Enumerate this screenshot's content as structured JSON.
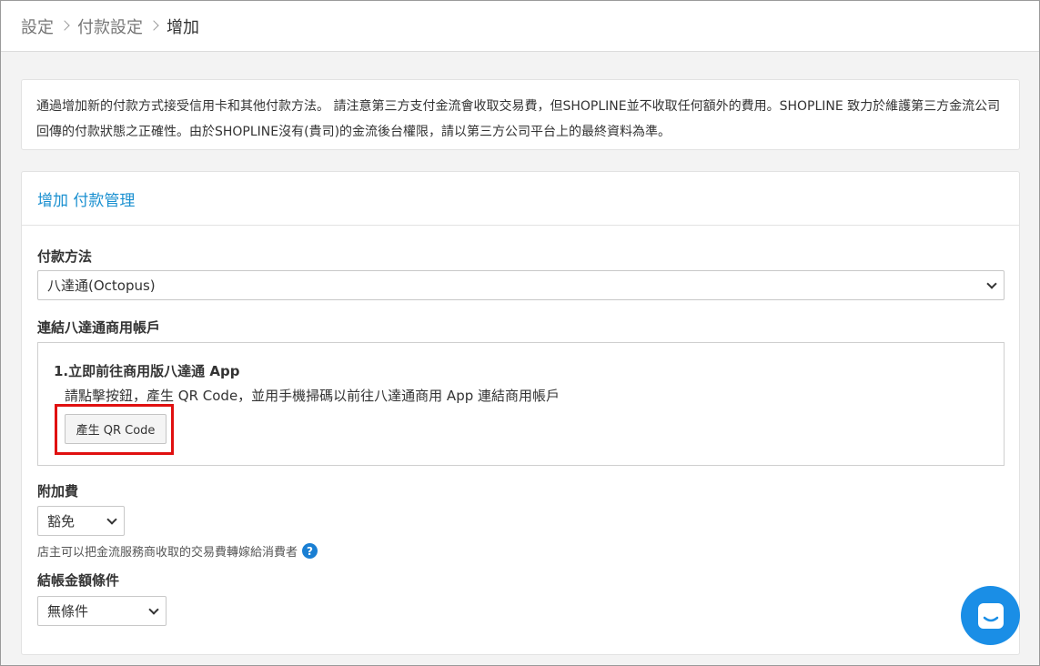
{
  "breadcrumb": {
    "items": [
      "設定",
      "付款設定",
      "增加"
    ]
  },
  "notice": {
    "text": "通過增加新的付款方式接受信用卡和其他付款方法。 請注意第三方支付金流會收取交易費，但SHOPLINE並不收取任何額外的費用。SHOPLINE 致力於維護第三方金流公司回傳的付款狀態之正確性。由於SHOPLINE沒有(貴司)的金流後台權限，請以第三方公司平台上的最終資料為準。"
  },
  "card": {
    "title": "增加 付款管理",
    "payment_method": {
      "label": "付款方法",
      "value": "八達通(Octopus)"
    },
    "link_account": {
      "label": "連結八達通商用帳戶",
      "step_title": "1.立即前往商用版八達通 App",
      "step_desc": "請點擊按鈕，產生 QR Code，並用手機掃碼以前往八達通商用 App 連結商用帳戶",
      "qr_button": "產生 QR Code"
    },
    "surcharge": {
      "label": "附加費",
      "value": "豁免",
      "help": "店主可以把金流服務商收取的交易費轉嫁給消費者",
      "help_icon": "question-icon"
    },
    "checkout_condition": {
      "label": "結帳金額條件",
      "value": "無條件"
    }
  },
  "chat": {
    "icon": "chat-icon",
    "color": "#1a8ee6"
  }
}
